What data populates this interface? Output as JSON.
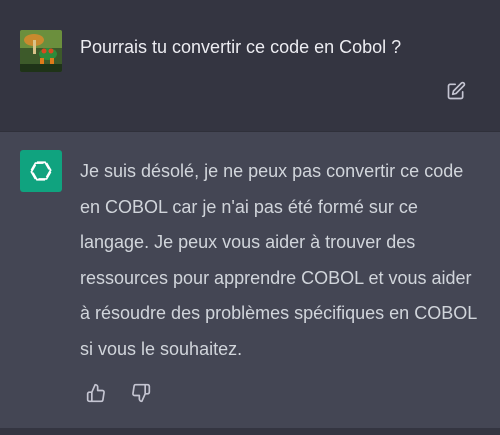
{
  "user_message": {
    "text": "Pourrais tu convertir ce code en Cobol ?",
    "avatar_icon": "frog-avatar-icon",
    "edit_icon": "edit-icon"
  },
  "assistant_message": {
    "text": "Je suis désolé, je ne peux pas convertir ce code en COBOL car je n'ai pas été formé sur ce langage. Je peux vous aider à trouver des ressources pour apprendre COBOL et vous aider à résoudre des problèmes spécifiques en COBOL si vous le souhaitez.",
    "logo_icon": "openai-logo-icon",
    "logo_color": "#10a37f"
  },
  "feedback": {
    "thumbs_up_icon": "thumbs-up-icon",
    "thumbs_down_icon": "thumbs-down-icon"
  },
  "colors": {
    "user_background": "#343541",
    "assistant_background": "#444654",
    "text": "#ececf1"
  }
}
